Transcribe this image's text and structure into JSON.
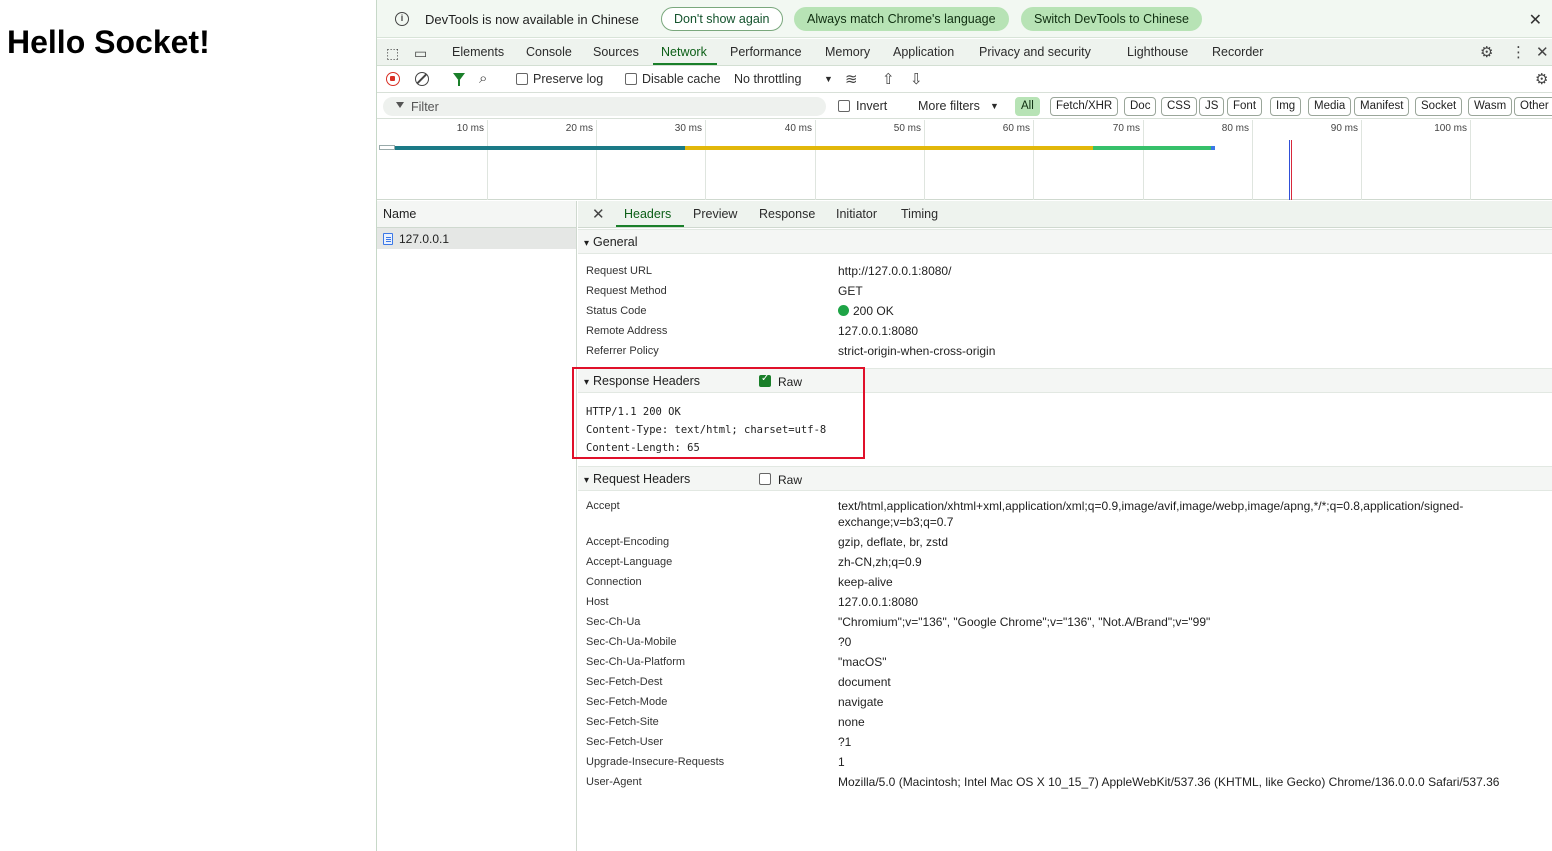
{
  "page": {
    "heading": "Hello Socket!"
  },
  "infobar": {
    "message": "DevTools is now available in Chinese",
    "dont_show": "Don't show again",
    "match_language": "Always match Chrome's language",
    "switch_language": "Switch DevTools to Chinese",
    "close": "✕"
  },
  "main_tabs": {
    "items": [
      "Elements",
      "Console",
      "Sources",
      "Network",
      "Performance",
      "Memory",
      "Application",
      "Privacy and security",
      "Lighthouse",
      "Recorder"
    ],
    "active": "Network"
  },
  "toolbar": {
    "preserve_log": "Preserve log",
    "disable_cache": "Disable cache",
    "throttling": "No throttling"
  },
  "filterbar": {
    "placeholder": "Filter",
    "invert": "Invert",
    "more_filters": "More filters",
    "types": [
      "All",
      "Fetch/XHR",
      "Doc",
      "CSS",
      "JS",
      "Font",
      "Img",
      "Media",
      "Manifest",
      "Socket",
      "Wasm",
      "Other"
    ],
    "active_type": "All"
  },
  "timeline": {
    "ticks": [
      "10 ms",
      "20 ms",
      "30 ms",
      "40 ms",
      "50 ms",
      "60 ms",
      "70 ms",
      "80 ms",
      "90 ms",
      "100 ms"
    ],
    "colors": {
      "stalled": "#1b7a86",
      "waiting": "#e2b70a",
      "download": "#36c06a",
      "dom": "#2f4fd8",
      "load": "#d8283a"
    }
  },
  "name_panel": {
    "header": "Name",
    "rows": [
      "127.0.0.1"
    ]
  },
  "detail_tabs": {
    "items": [
      "Headers",
      "Preview",
      "Response",
      "Initiator",
      "Timing"
    ],
    "active": "Headers",
    "close": "✕"
  },
  "general": {
    "title": "General",
    "rows": [
      {
        "key": "Request URL",
        "value": "http://127.0.0.1:8080/"
      },
      {
        "key": "Request Method",
        "value": "GET"
      },
      {
        "key": "Status Code",
        "value": "200 OK"
      },
      {
        "key": "Remote Address",
        "value": "127.0.0.1:8080"
      },
      {
        "key": "Referrer Policy",
        "value": "strict-origin-when-cross-origin"
      }
    ],
    "status_color": "#1ea446"
  },
  "response_headers": {
    "title": "Response Headers",
    "raw_label": "Raw",
    "raw_checked": true,
    "lines": [
      "HTTP/1.1 200 OK",
      "Content-Type: text/html; charset=utf-8",
      "Content-Length: 65"
    ]
  },
  "request_headers": {
    "title": "Request Headers",
    "raw_label": "Raw",
    "raw_checked": false,
    "rows": [
      {
        "key": "Accept",
        "value": "text/html,application/xhtml+xml,application/xml;q=0.9,image/avif,image/webp,image/apng,*/*;q=0.8,application/signed-exchange;v=b3;q=0.7"
      },
      {
        "key": "Accept-Encoding",
        "value": "gzip, deflate, br, zstd"
      },
      {
        "key": "Accept-Language",
        "value": "zh-CN,zh;q=0.9"
      },
      {
        "key": "Connection",
        "value": "keep-alive"
      },
      {
        "key": "Host",
        "value": "127.0.0.1:8080"
      },
      {
        "key": "Sec-Ch-Ua",
        "value": "\"Chromium\";v=\"136\", \"Google Chrome\";v=\"136\", \"Not.A/Brand\";v=\"99\""
      },
      {
        "key": "Sec-Ch-Ua-Mobile",
        "value": "?0"
      },
      {
        "key": "Sec-Ch-Ua-Platform",
        "value": "\"macOS\""
      },
      {
        "key": "Sec-Fetch-Dest",
        "value": "document"
      },
      {
        "key": "Sec-Fetch-Mode",
        "value": "navigate"
      },
      {
        "key": "Sec-Fetch-Site",
        "value": "none"
      },
      {
        "key": "Sec-Fetch-User",
        "value": "?1"
      },
      {
        "key": "Upgrade-Insecure-Requests",
        "value": "1"
      },
      {
        "key": "User-Agent",
        "value": "Mozilla/5.0 (Macintosh; Intel Mac OS X 10_15_7) AppleWebKit/537.36 (KHTML, like Gecko) Chrome/136.0.0.0 Safari/537.36"
      }
    ]
  },
  "annotation": {
    "color": "#e0102a"
  }
}
